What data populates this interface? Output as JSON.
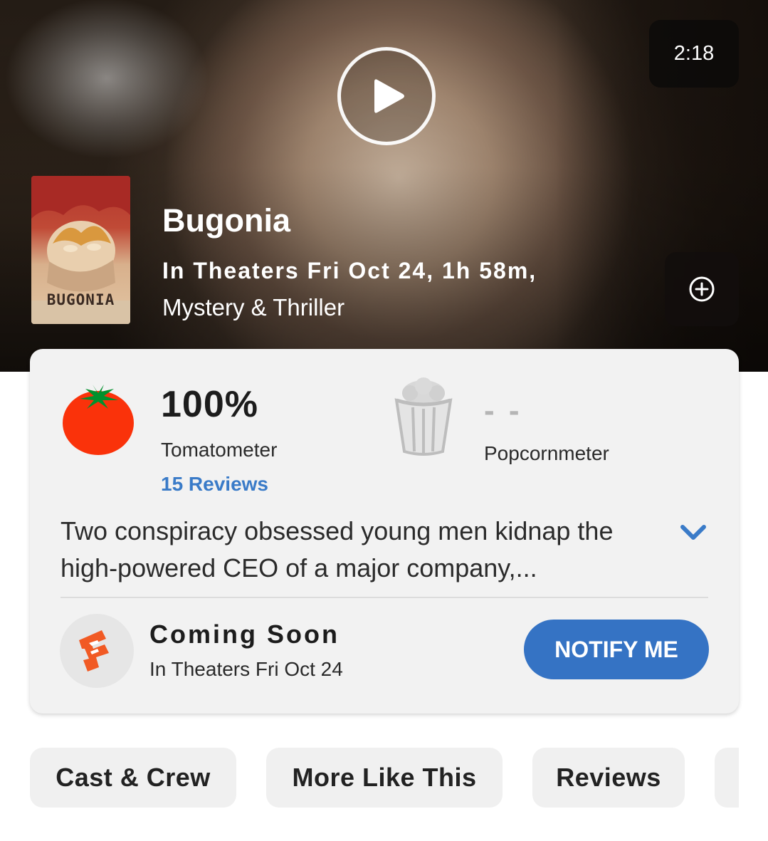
{
  "hero": {
    "duration": "2:18",
    "poster_title": "BUGONIA"
  },
  "movie": {
    "title": "Bugonia",
    "meta": "In Theaters Fri Oct 24, 1h 58m,",
    "genre": "Mystery & Thriller"
  },
  "scores": {
    "tomatometer": {
      "value": "100%",
      "label": "Tomatometer",
      "reviews": "15 Reviews"
    },
    "popcornmeter": {
      "value": "- -",
      "label": "Popcornmeter"
    }
  },
  "synopsis": "Two conspiracy obsessed young men kidnap the high-powered CEO of a major company,...",
  "tickets": {
    "status": "Coming Soon",
    "release": "In Theaters Fri Oct 24",
    "button_label": "NOTIFY ME"
  },
  "tabs": [
    {
      "label": "Cast & Crew"
    },
    {
      "label": "More Like This"
    },
    {
      "label": "Reviews"
    },
    {
      "label": ""
    }
  ],
  "colors": {
    "accent_blue": "#3573c4",
    "link_blue": "#3a7bc8",
    "tomato_red": "#fa320a",
    "fandango_orange": "#f15a24"
  },
  "icons": [
    "play-icon",
    "add-icon",
    "tomato-icon",
    "popcorn-icon",
    "chevron-down-icon",
    "fandango-icon"
  ]
}
